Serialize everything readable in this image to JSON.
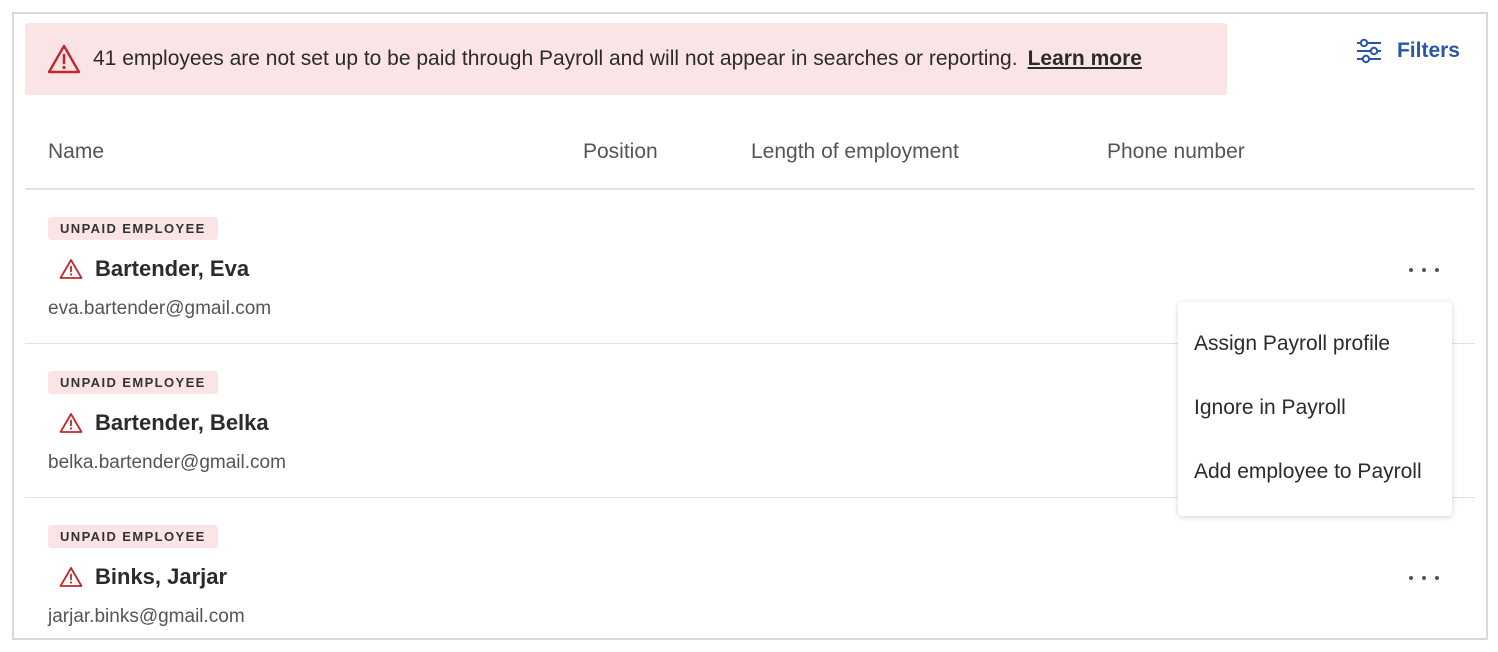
{
  "alert": {
    "icon": "warning-triangle-icon",
    "message": "41 employees are not set up to be paid through Payroll and will not appear in searches or reporting.",
    "link": "Learn more",
    "background": "#fbe4e6",
    "icon_color": "#c0282e"
  },
  "filters": {
    "label": "Filters",
    "icon": "sliders-icon",
    "color": "#2d55a8"
  },
  "table": {
    "columns": [
      "Name",
      "Position",
      "Length of employment",
      "Phone number"
    ],
    "rows": [
      {
        "badge": "UNPAID EMPLOYEE",
        "name": "Bartender, Eva",
        "email": "eva.bartender@gmail.com",
        "position": "",
        "length": "",
        "phone": ""
      },
      {
        "badge": "UNPAID EMPLOYEE",
        "name": "Bartender, Belka",
        "email": "belka.bartender@gmail.com",
        "position": "",
        "length": "",
        "phone": ""
      },
      {
        "badge": "UNPAID EMPLOYEE",
        "name": "Binks, Jarjar",
        "email": "jarjar.binks@gmail.com",
        "position": "",
        "length": "",
        "phone": ""
      }
    ]
  },
  "menu": {
    "items": [
      "Assign Payroll profile",
      "Ignore in Payroll",
      "Add employee to Payroll"
    ]
  }
}
